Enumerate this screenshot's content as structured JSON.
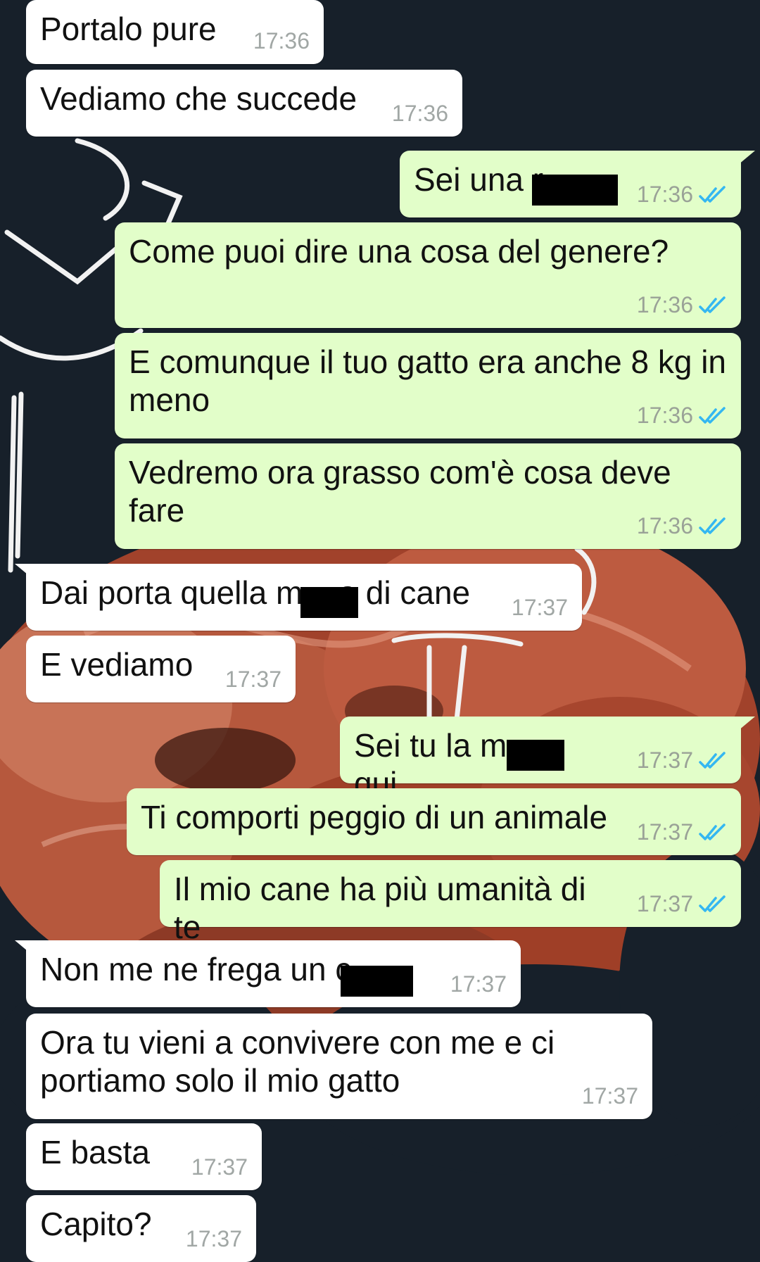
{
  "colors": {
    "incoming_bubble": "#ffffff",
    "outgoing_bubble": "#e2fec9",
    "read_ticks": "#34b7f1",
    "timestamp": "#a1a7a5"
  },
  "icons": {
    "read_receipt": "double-check-icon"
  },
  "messages": [
    {
      "dir": "in",
      "text": "Portalo pure",
      "time": "17:36"
    },
    {
      "dir": "in",
      "text": "Vediamo che succede",
      "time": "17:36"
    },
    {
      "dir": "out",
      "text": "Sei una r",
      "time": "17:36",
      "read": true,
      "redacted": true
    },
    {
      "dir": "out",
      "text": "Come puoi dire una cosa del genere?",
      "time": "17:36",
      "read": true
    },
    {
      "dir": "out",
      "text": "E comunque il tuo gatto era anche 8 kg in meno",
      "time": "17:36",
      "read": true
    },
    {
      "dir": "out",
      "text": "Vedremo ora grasso com'è cosa deve fare",
      "time": "17:36",
      "read": true
    },
    {
      "dir": "in",
      "text": "Dai porta quella m    a di cane",
      "time": "17:37",
      "redacted": true
    },
    {
      "dir": "in",
      "text": "E vediamo",
      "time": "17:37"
    },
    {
      "dir": "out",
      "text": "Sei tu la m        qui",
      "time": "17:37",
      "read": true,
      "redacted": true
    },
    {
      "dir": "out",
      "text": "Ti comporti peggio di un animale",
      "time": "17:37",
      "read": true
    },
    {
      "dir": "out",
      "text": "Il mio cane ha più umanità di te",
      "time": "17:37",
      "read": true
    },
    {
      "dir": "in",
      "text": "Non me ne frega un c",
      "time": "17:37",
      "redacted": true
    },
    {
      "dir": "in",
      "text": "Ora tu vieni a convivere con me e ci portiamo solo il mio gatto",
      "time": "17:37"
    },
    {
      "dir": "in",
      "text": "E basta",
      "time": "17:37"
    },
    {
      "dir": "in",
      "text": "Capito?",
      "time": "17:37"
    }
  ]
}
